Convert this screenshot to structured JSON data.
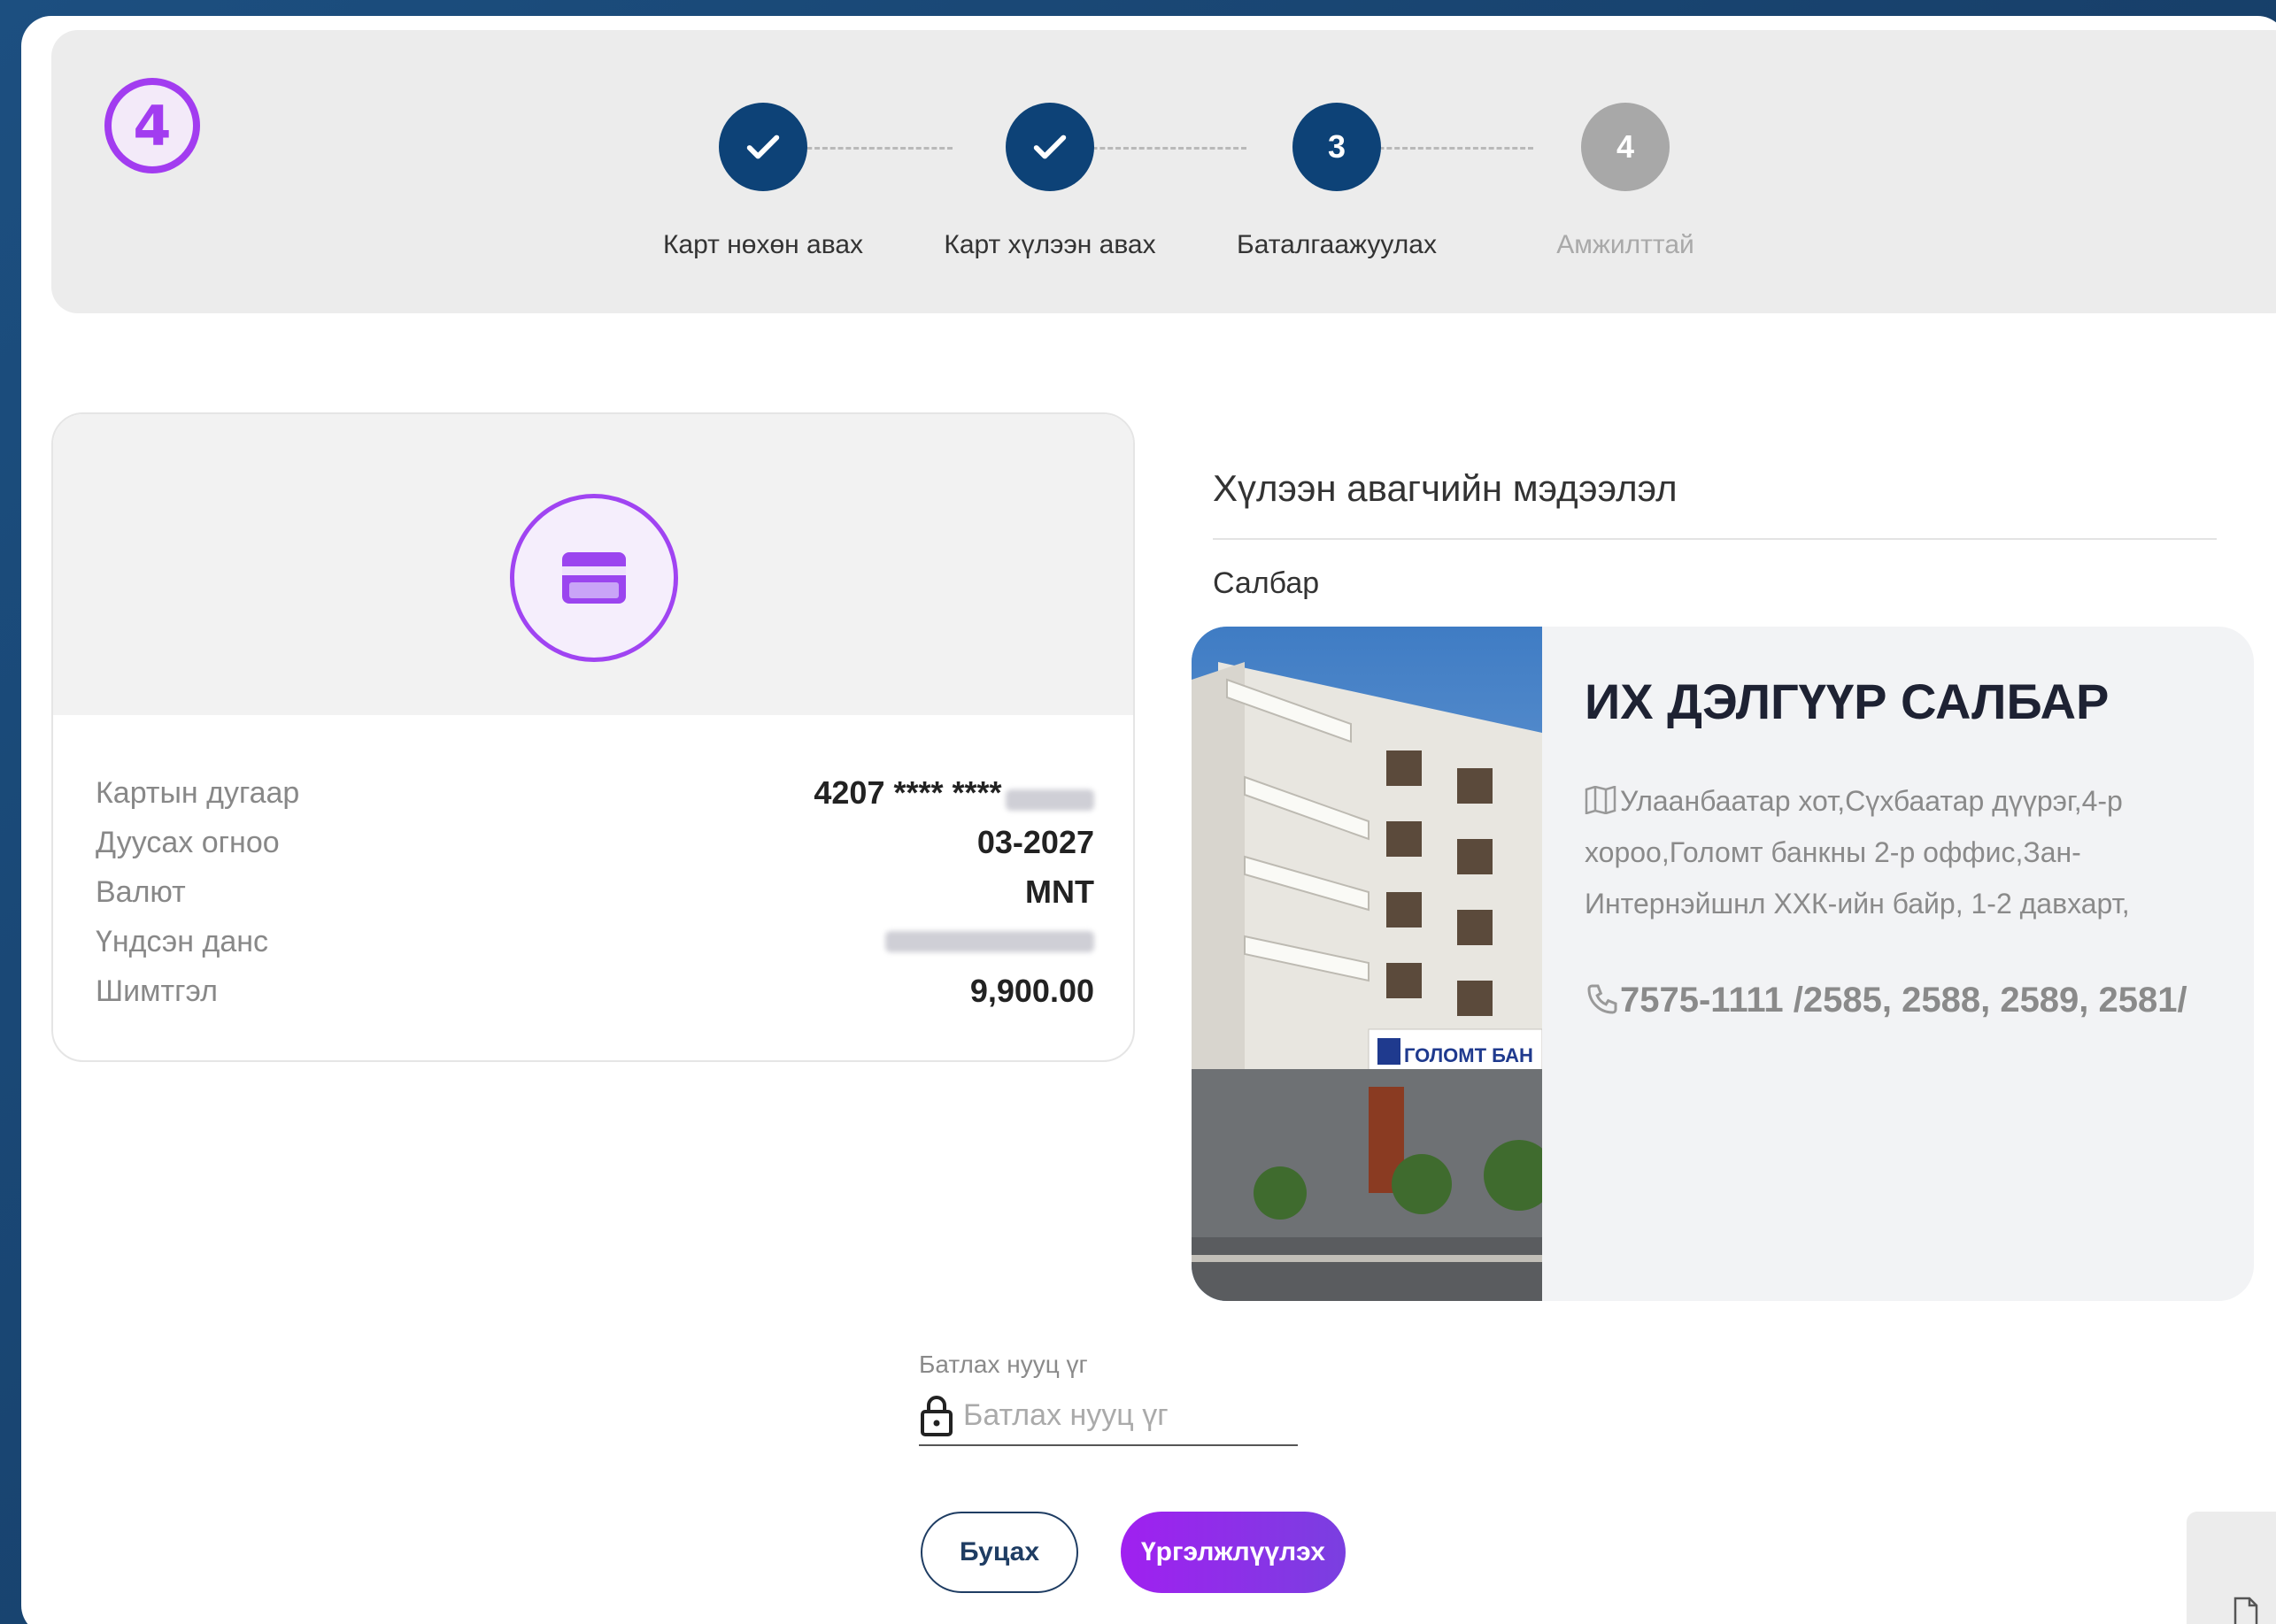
{
  "badge": {
    "number": "4"
  },
  "stepper": {
    "steps": [
      {
        "label": "Карт нөхөн авах",
        "state": "done"
      },
      {
        "label": "Карт хүлээн авах",
        "state": "done"
      },
      {
        "label": "Баталгаажуулах",
        "state": "active",
        "number": "3"
      },
      {
        "label": "Амжилттай",
        "state": "pending",
        "number": "4"
      }
    ]
  },
  "card": {
    "icon": "credit-card-icon",
    "rows": [
      {
        "label": "Картын дугаар",
        "value": "4207 **** ****"
      },
      {
        "label": "Дуусах огноо",
        "value": "03-2027"
      },
      {
        "label": "Валют",
        "value": "MNT"
      },
      {
        "label": "Үндсэн данс",
        "value": ""
      },
      {
        "label": "Шимтгэл",
        "value": "9,900.00"
      }
    ]
  },
  "receiver": {
    "title": "Хүлээн авагчийн мэдээлэл",
    "branch_label": "Салбар",
    "branch": {
      "name": "ИХ ДЭЛГҮҮР САЛБАР",
      "address": "Улаанбаатар хот,Сүхбаатар дүүрэг,4-р хороо,Голомт банкны 2-р оффис,Зан-Интернэйшнл ХХК-ийн байр, 1-2 давхарт,",
      "phone": "7575-1111 /2585, 2588, 2589, 2581/",
      "sign_text": "ГОЛОМТ БАН"
    }
  },
  "password": {
    "label": "Батлах нууц үг",
    "placeholder": "Батлах нууц үг"
  },
  "buttons": {
    "back": "Буцах",
    "continue": "Үргэлжлүүлэх"
  },
  "colors": {
    "primary": "#0d4277",
    "accent": "#a023f0",
    "pending": "#a8a8a8"
  }
}
